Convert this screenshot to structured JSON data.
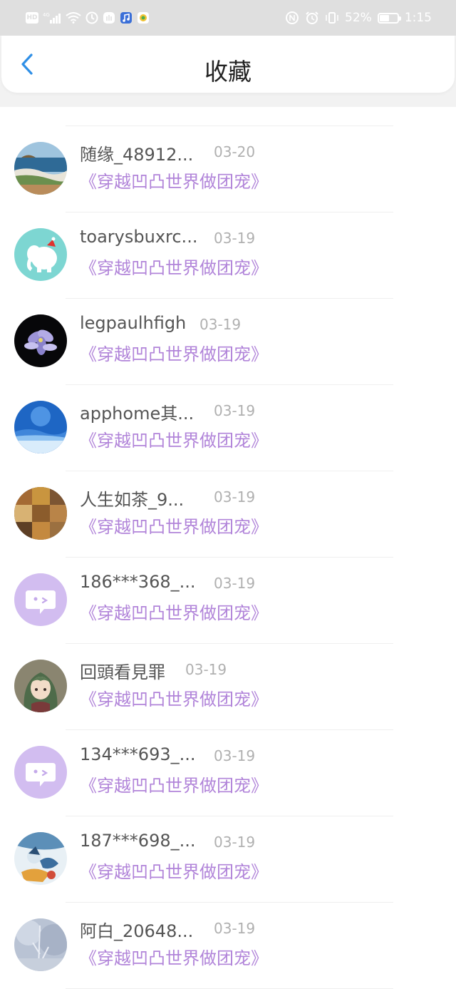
{
  "status_bar": {
    "left_icons": [
      "hd-icon",
      "4g-signal-icon",
      "wifi-icon",
      "app-icon",
      "hand-icon",
      "music-icon",
      "app-badge-icon"
    ],
    "battery": "52%",
    "time": "1:15"
  },
  "header": {
    "title": "收藏",
    "back_icon": "chevron-left-icon"
  },
  "colors": {
    "accent": "#2f8fe6",
    "book_title": "#b184d9",
    "name": "#555555",
    "date": "#b0b0b0"
  },
  "items": [
    {
      "name": "随缘_48912...",
      "date": "03-20",
      "book": "《穿越凹凸世界做团宠》",
      "avatar": "beach-photo-avatar"
    },
    {
      "name": "toarysbuxrc...",
      "date": "03-19",
      "book": "《穿越凹凸世界做团宠》",
      "avatar": "elephant-avatar"
    },
    {
      "name": "legpaulhfigh",
      "date": "03-19",
      "book": "《穿越凹凸世界做团宠》",
      "avatar": "flower-avatar"
    },
    {
      "name": "apphome其...",
      "date": "03-19",
      "book": "《穿越凹凸世界做团宠》",
      "avatar": "blue-landscape-avatar"
    },
    {
      "name": "人生如茶_9...",
      "date": "03-19",
      "book": "《穿越凹凸世界做团宠》",
      "avatar": "food-collage-avatar"
    },
    {
      "name": "186***368_...",
      "date": "03-19",
      "book": "《穿越凹凸世界做团宠》",
      "avatar": "default-chat-avatar"
    },
    {
      "name": "回頭看見罪",
      "date": "03-19",
      "book": "《穿越凹凸世界做团宠》",
      "avatar": "anime-girl-avatar"
    },
    {
      "name": "134***693_...",
      "date": "03-19",
      "book": "《穿越凹凸世界做团宠》",
      "avatar": "default-chat-avatar"
    },
    {
      "name": "187***698_...",
      "date": "03-19",
      "book": "《穿越凹凸世界做团宠》",
      "avatar": "illustration-avatar"
    },
    {
      "name": "阿白_20648...",
      "date": "03-19",
      "book": "《穿越凹凸世界做团宠》",
      "avatar": "frost-avatar"
    }
  ]
}
